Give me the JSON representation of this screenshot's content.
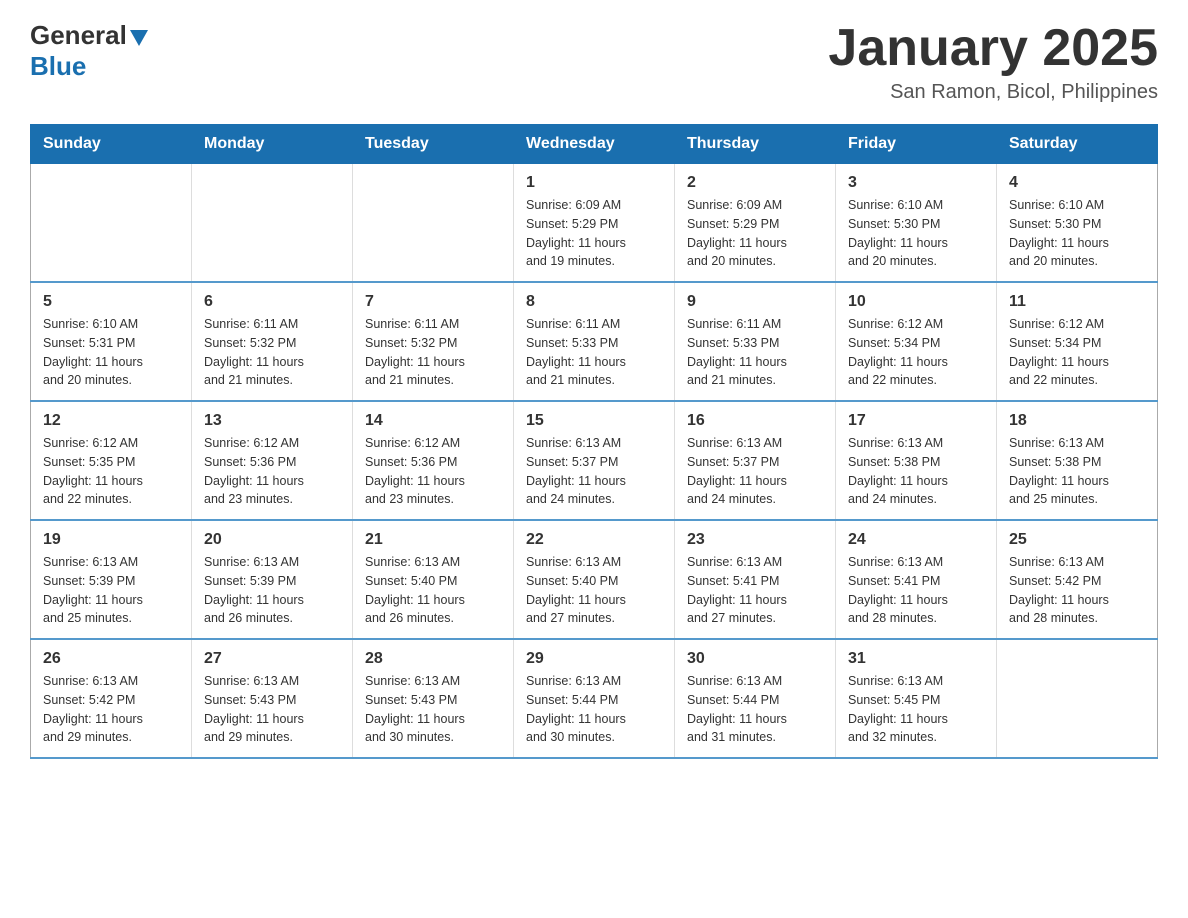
{
  "logo": {
    "text_general": "General",
    "text_blue": "Blue"
  },
  "header": {
    "month_title": "January 2025",
    "location": "San Ramon, Bicol, Philippines"
  },
  "days_of_week": [
    "Sunday",
    "Monday",
    "Tuesday",
    "Wednesday",
    "Thursday",
    "Friday",
    "Saturday"
  ],
  "weeks": [
    [
      {
        "day": "",
        "info": ""
      },
      {
        "day": "",
        "info": ""
      },
      {
        "day": "",
        "info": ""
      },
      {
        "day": "1",
        "info": "Sunrise: 6:09 AM\nSunset: 5:29 PM\nDaylight: 11 hours\nand 19 minutes."
      },
      {
        "day": "2",
        "info": "Sunrise: 6:09 AM\nSunset: 5:29 PM\nDaylight: 11 hours\nand 20 minutes."
      },
      {
        "day": "3",
        "info": "Sunrise: 6:10 AM\nSunset: 5:30 PM\nDaylight: 11 hours\nand 20 minutes."
      },
      {
        "day": "4",
        "info": "Sunrise: 6:10 AM\nSunset: 5:30 PM\nDaylight: 11 hours\nand 20 minutes."
      }
    ],
    [
      {
        "day": "5",
        "info": "Sunrise: 6:10 AM\nSunset: 5:31 PM\nDaylight: 11 hours\nand 20 minutes."
      },
      {
        "day": "6",
        "info": "Sunrise: 6:11 AM\nSunset: 5:32 PM\nDaylight: 11 hours\nand 21 minutes."
      },
      {
        "day": "7",
        "info": "Sunrise: 6:11 AM\nSunset: 5:32 PM\nDaylight: 11 hours\nand 21 minutes."
      },
      {
        "day": "8",
        "info": "Sunrise: 6:11 AM\nSunset: 5:33 PM\nDaylight: 11 hours\nand 21 minutes."
      },
      {
        "day": "9",
        "info": "Sunrise: 6:11 AM\nSunset: 5:33 PM\nDaylight: 11 hours\nand 21 minutes."
      },
      {
        "day": "10",
        "info": "Sunrise: 6:12 AM\nSunset: 5:34 PM\nDaylight: 11 hours\nand 22 minutes."
      },
      {
        "day": "11",
        "info": "Sunrise: 6:12 AM\nSunset: 5:34 PM\nDaylight: 11 hours\nand 22 minutes."
      }
    ],
    [
      {
        "day": "12",
        "info": "Sunrise: 6:12 AM\nSunset: 5:35 PM\nDaylight: 11 hours\nand 22 minutes."
      },
      {
        "day": "13",
        "info": "Sunrise: 6:12 AM\nSunset: 5:36 PM\nDaylight: 11 hours\nand 23 minutes."
      },
      {
        "day": "14",
        "info": "Sunrise: 6:12 AM\nSunset: 5:36 PM\nDaylight: 11 hours\nand 23 minutes."
      },
      {
        "day": "15",
        "info": "Sunrise: 6:13 AM\nSunset: 5:37 PM\nDaylight: 11 hours\nand 24 minutes."
      },
      {
        "day": "16",
        "info": "Sunrise: 6:13 AM\nSunset: 5:37 PM\nDaylight: 11 hours\nand 24 minutes."
      },
      {
        "day": "17",
        "info": "Sunrise: 6:13 AM\nSunset: 5:38 PM\nDaylight: 11 hours\nand 24 minutes."
      },
      {
        "day": "18",
        "info": "Sunrise: 6:13 AM\nSunset: 5:38 PM\nDaylight: 11 hours\nand 25 minutes."
      }
    ],
    [
      {
        "day": "19",
        "info": "Sunrise: 6:13 AM\nSunset: 5:39 PM\nDaylight: 11 hours\nand 25 minutes."
      },
      {
        "day": "20",
        "info": "Sunrise: 6:13 AM\nSunset: 5:39 PM\nDaylight: 11 hours\nand 26 minutes."
      },
      {
        "day": "21",
        "info": "Sunrise: 6:13 AM\nSunset: 5:40 PM\nDaylight: 11 hours\nand 26 minutes."
      },
      {
        "day": "22",
        "info": "Sunrise: 6:13 AM\nSunset: 5:40 PM\nDaylight: 11 hours\nand 27 minutes."
      },
      {
        "day": "23",
        "info": "Sunrise: 6:13 AM\nSunset: 5:41 PM\nDaylight: 11 hours\nand 27 minutes."
      },
      {
        "day": "24",
        "info": "Sunrise: 6:13 AM\nSunset: 5:41 PM\nDaylight: 11 hours\nand 28 minutes."
      },
      {
        "day": "25",
        "info": "Sunrise: 6:13 AM\nSunset: 5:42 PM\nDaylight: 11 hours\nand 28 minutes."
      }
    ],
    [
      {
        "day": "26",
        "info": "Sunrise: 6:13 AM\nSunset: 5:42 PM\nDaylight: 11 hours\nand 29 minutes."
      },
      {
        "day": "27",
        "info": "Sunrise: 6:13 AM\nSunset: 5:43 PM\nDaylight: 11 hours\nand 29 minutes."
      },
      {
        "day": "28",
        "info": "Sunrise: 6:13 AM\nSunset: 5:43 PM\nDaylight: 11 hours\nand 30 minutes."
      },
      {
        "day": "29",
        "info": "Sunrise: 6:13 AM\nSunset: 5:44 PM\nDaylight: 11 hours\nand 30 minutes."
      },
      {
        "day": "30",
        "info": "Sunrise: 6:13 AM\nSunset: 5:44 PM\nDaylight: 11 hours\nand 31 minutes."
      },
      {
        "day": "31",
        "info": "Sunrise: 6:13 AM\nSunset: 5:45 PM\nDaylight: 11 hours\nand 32 minutes."
      },
      {
        "day": "",
        "info": ""
      }
    ]
  ]
}
